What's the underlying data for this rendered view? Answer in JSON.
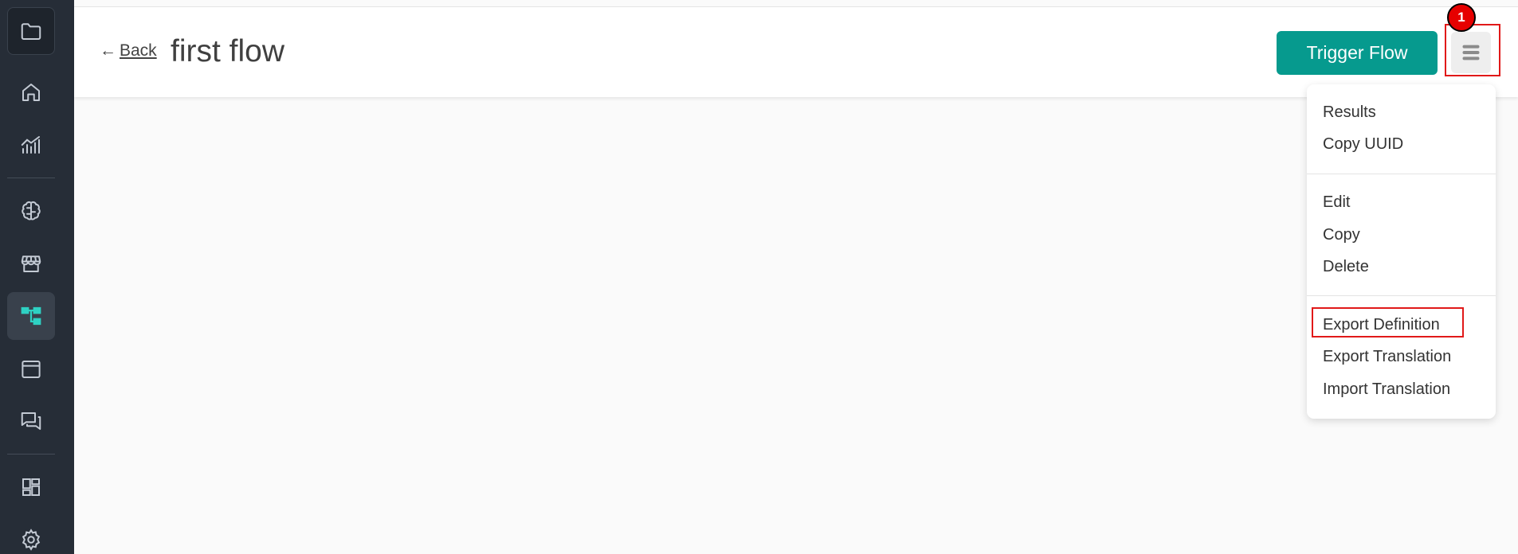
{
  "sidebar": {
    "items": [
      {
        "name": "folder-icon",
        "active": false
      },
      {
        "name": "home-icon",
        "active": false
      },
      {
        "name": "analytics-icon",
        "active": false
      },
      {
        "name": "brain-icon",
        "active": false
      },
      {
        "name": "store-icon",
        "active": false
      },
      {
        "name": "flows-icon",
        "active": true
      },
      {
        "name": "window-icon",
        "active": false
      },
      {
        "name": "chat-icon",
        "active": false
      },
      {
        "name": "dashboard-icon",
        "active": false
      },
      {
        "name": "settings-icon",
        "active": false
      }
    ]
  },
  "header": {
    "back_arrow": "←",
    "back_label": "Back",
    "title": "first flow",
    "trigger_label": "Trigger Flow",
    "menu_icon": "menu-icon"
  },
  "annotation": {
    "badge": "1",
    "color": "#e11919"
  },
  "menu": {
    "groups": [
      [
        "Results",
        "Copy UUID"
      ],
      [
        "Edit",
        "Copy",
        "Delete"
      ],
      [
        "Export Definition",
        "Export Translation",
        "Import Translation"
      ]
    ]
  },
  "colors": {
    "sidebar_bg": "#262d37",
    "accent": "#069a8e",
    "active_icon": "#2ed1c3"
  }
}
